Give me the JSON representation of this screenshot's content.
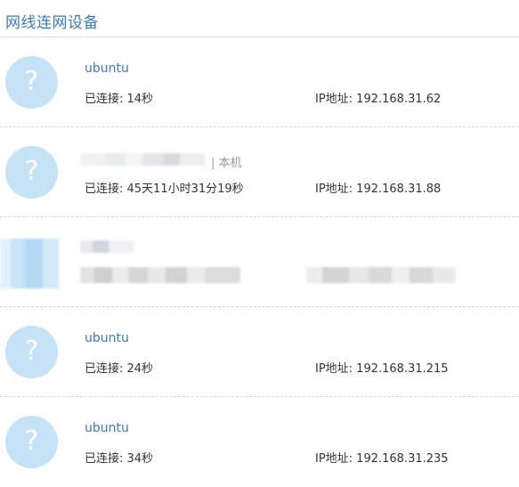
{
  "header": {
    "title": "网线连网设备"
  },
  "devices": [
    {
      "name": "ubuntu",
      "local_tag": "",
      "connected": "已连接: 14秒",
      "ip": "IP地址: 192.168.31.62",
      "avatar_glyph": "?",
      "icon": "unknown-device-icon"
    },
    {
      "name": "",
      "local_tag": "| 本机",
      "connected": "已连接: 45天11小时31分19秒",
      "ip": "IP地址: 192.168.31.88",
      "avatar_glyph": "?",
      "icon": "unknown-device-icon"
    },
    {
      "name": "",
      "local_tag": "",
      "connected": "",
      "ip": "",
      "avatar_glyph": "",
      "icon": "unknown-device-icon"
    },
    {
      "name": "ubuntu",
      "local_tag": "",
      "connected": "已连接: 24秒",
      "ip": "IP地址: 192.168.31.215",
      "avatar_glyph": "?",
      "icon": "unknown-device-icon"
    },
    {
      "name": "ubuntu",
      "local_tag": "",
      "connected": "已连接: 34秒",
      "ip": "IP地址: 192.168.31.235",
      "avatar_glyph": "?",
      "icon": "unknown-device-icon"
    }
  ],
  "colors": {
    "title": "#3b7bbf",
    "avatar": "#c5e2f7",
    "divider": "#d6d6d6"
  }
}
